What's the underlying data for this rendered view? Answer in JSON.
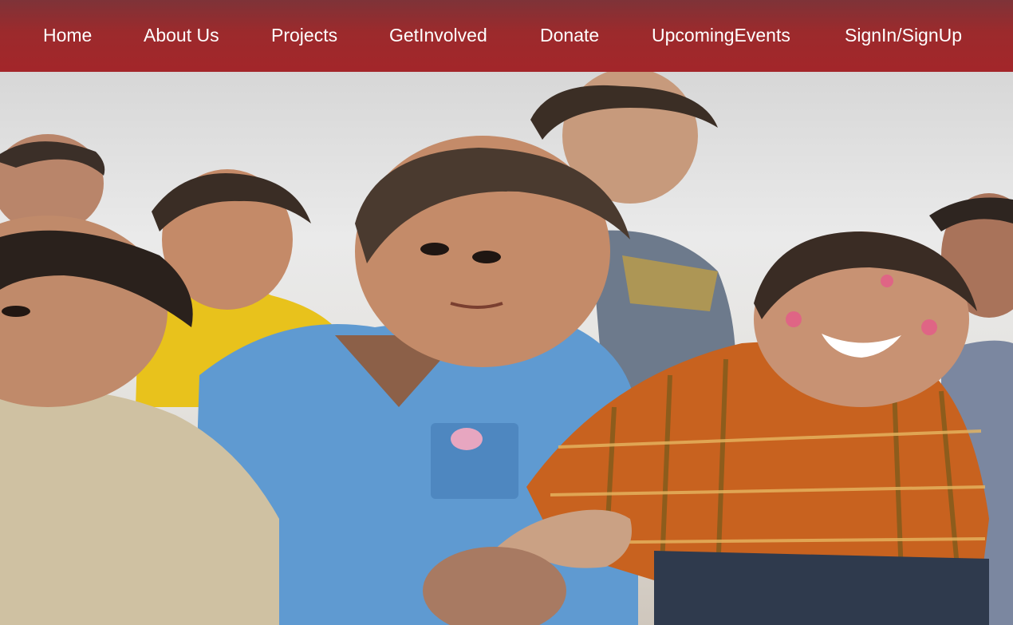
{
  "nav": {
    "items": [
      {
        "label": "Home"
      },
      {
        "label": "About Us"
      },
      {
        "label": "Projects"
      },
      {
        "label": "GetInvolved"
      },
      {
        "label": "Donate"
      },
      {
        "label": "UpcomingEvents"
      },
      {
        "label": "SignIn/SignUp"
      }
    ],
    "background": "#9c2a2c",
    "text_color": "#ffffff"
  },
  "hero": {
    "image": "group-of-smiling-children-photo"
  }
}
